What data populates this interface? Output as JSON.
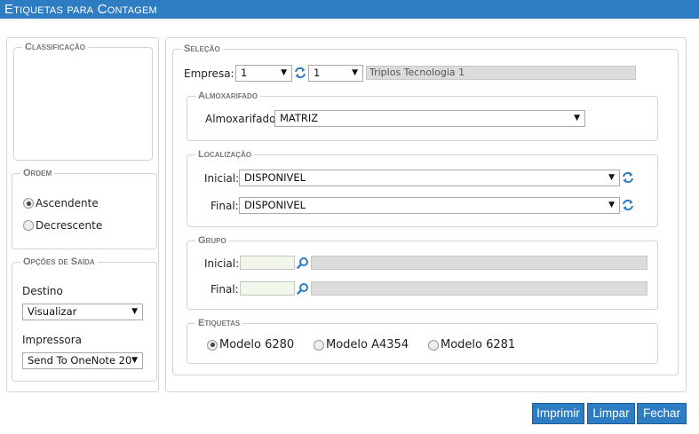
{
  "window": {
    "title": "Etiquetas para Contagem"
  },
  "left": {
    "classificacao": {
      "legend": "Classificação"
    },
    "ordem": {
      "legend": "Ordem",
      "options": [
        {
          "label": "Ascendente",
          "checked": true
        },
        {
          "label": "Decrescente",
          "checked": false
        }
      ]
    },
    "opcoes": {
      "legend": "Opções de Saída",
      "destino_label": "Destino",
      "destino_value": "Visualizar",
      "impressora_label": "Impressora",
      "impressora_value": "Send To OneNote 20"
    }
  },
  "selecao": {
    "legend": "Seleção",
    "empresa_label": "Empresa:",
    "empresa_code": "1",
    "empresa_branch": "1",
    "empresa_name": "Triplos Tecnologia 1",
    "almoxarifado": {
      "legend": "Almoxarifado",
      "label": "Almoxarifado:",
      "value": "MATRIZ"
    },
    "localizacao": {
      "legend": "Localização",
      "inicial_label": "Inicial:",
      "inicial_value": "DISPONIVEL",
      "final_label": "Final:",
      "final_value": "DISPONIVEL"
    },
    "grupo": {
      "legend": "Grupo",
      "inicial_label": "Inicial:",
      "final_label": "Final:"
    },
    "etiquetas": {
      "legend": "Etiquetas",
      "options": [
        {
          "label": "Modelo 6280",
          "checked": true
        },
        {
          "label": "Modelo A4354",
          "checked": false
        },
        {
          "label": "Modelo 6281",
          "checked": false
        }
      ]
    }
  },
  "buttons": {
    "imprimir": "Imprimir",
    "limpar": "Limpar",
    "fechar": "Fechar"
  },
  "colors": {
    "accent": "#2e7cc2",
    "border": "#d3d3d3",
    "readonly_bg": "#dcdcdc",
    "input_bg": "#f1f7ea"
  }
}
